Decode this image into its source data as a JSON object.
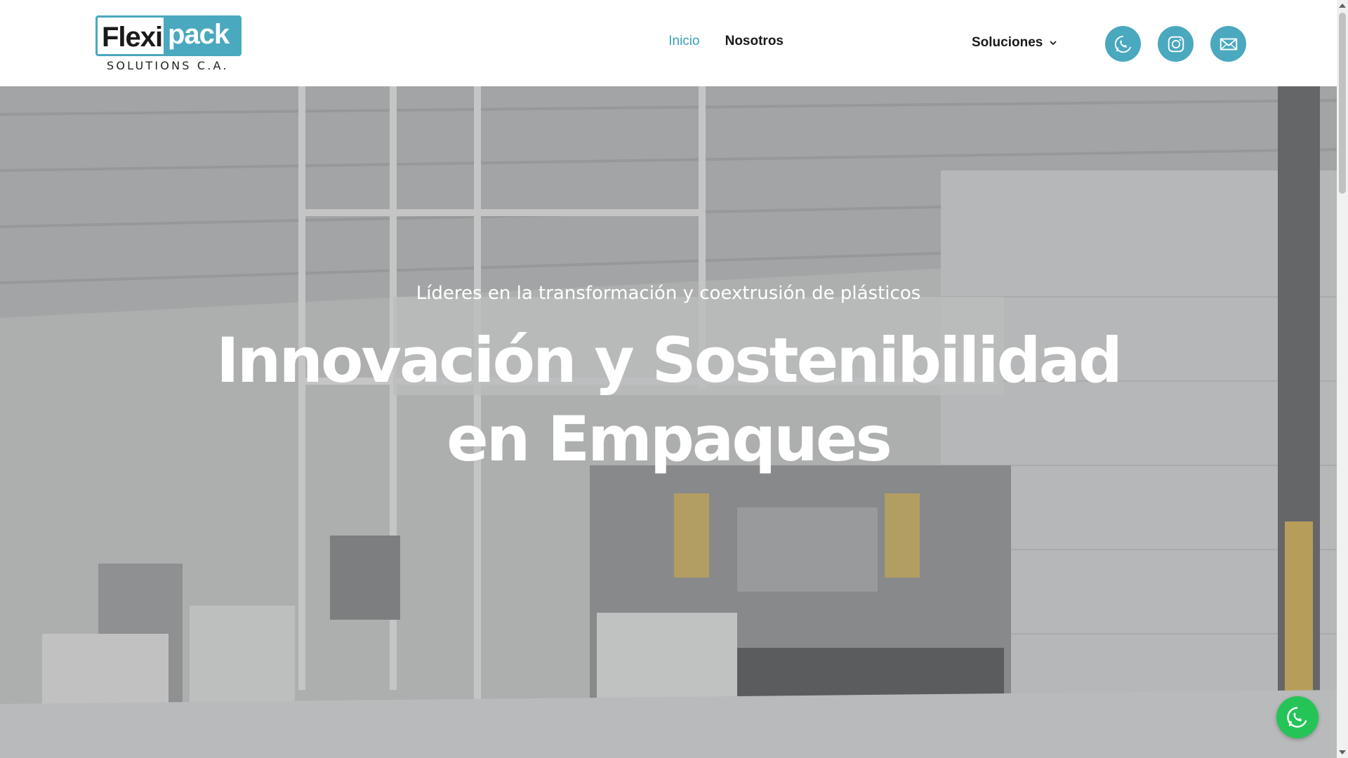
{
  "brand": {
    "logo_main_left": "Flexi",
    "logo_main_right": "pack",
    "logo_sub": "SOLUTIONS C.A.",
    "accent_color": "#4aa8bf"
  },
  "nav": {
    "items": [
      {
        "label": "Inicio",
        "active": true
      },
      {
        "label": "Nosotros",
        "active": false
      },
      {
        "label": "Soluciones",
        "active": false,
        "has_dropdown": true
      }
    ],
    "social": [
      {
        "icon": "whatsapp-icon"
      },
      {
        "icon": "instagram-icon"
      },
      {
        "icon": "mail-icon"
      }
    ]
  },
  "hero": {
    "subtitle": "Líderes en la transformación y coextrusión de plásticos",
    "title": "Innovación y Sostenibilidad en Empaques"
  },
  "floating": {
    "icon": "whatsapp-icon",
    "color": "#25c457"
  }
}
